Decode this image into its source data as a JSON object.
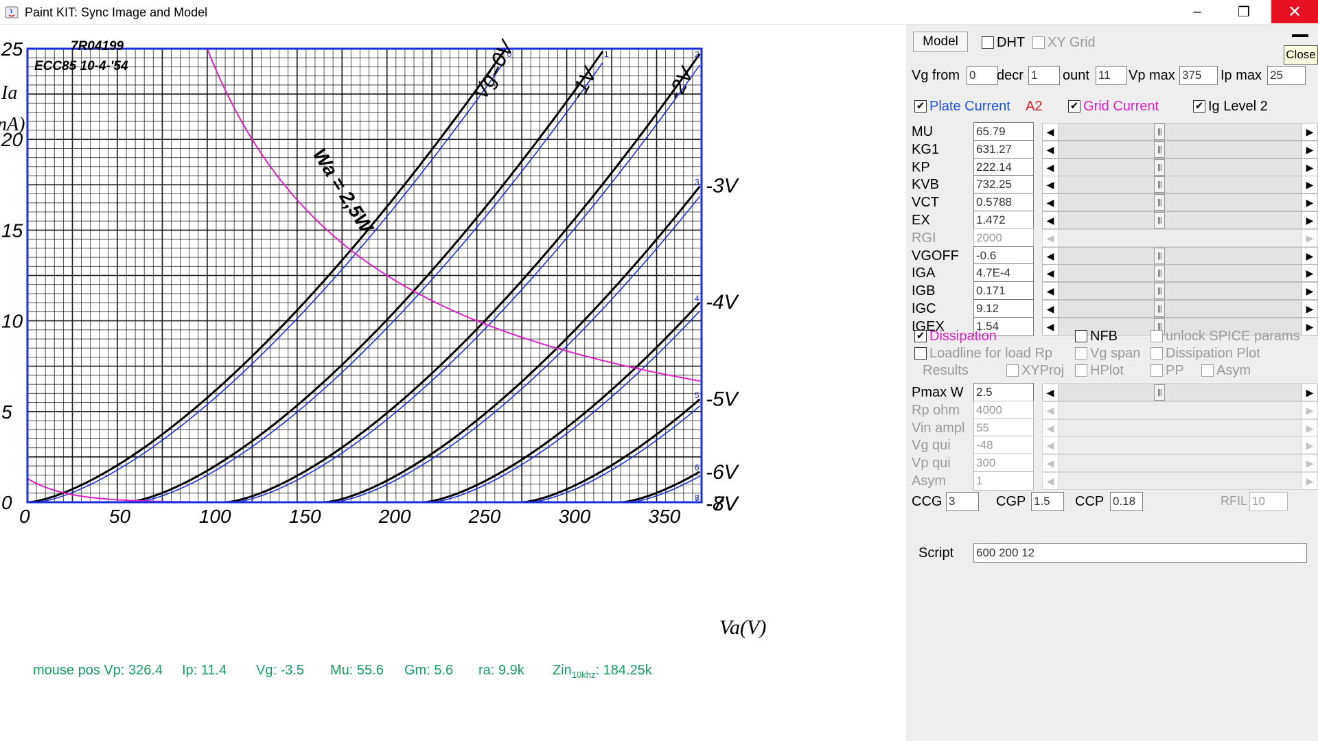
{
  "window": {
    "title": "Paint KIT: Sync Image and Model",
    "minimize": "–",
    "maximize": "❐",
    "close": "✕"
  },
  "chart_data": {
    "type": "line",
    "header_left": "7R04199",
    "header_date": "ECC85 10-4-'54",
    "ylabel_main": "Ia",
    "ylabel_unit": "nA)",
    "xlabel": "Va(V)",
    "x_ticks": [
      0,
      50,
      100,
      150,
      200,
      250,
      300,
      350
    ],
    "y_ticks": [
      0,
      5,
      10,
      15,
      20,
      25
    ],
    "xlim": [
      0,
      375
    ],
    "ylim": [
      0,
      25
    ],
    "dissipation_label": "Wa = 2,5W",
    "dissipation_watts": 2.5,
    "grid_labels": [
      {
        "text": "Vg=0V",
        "vg": 0
      },
      {
        "text": "-1V",
        "vg": -1
      },
      {
        "text": "-2V",
        "vg": -2
      },
      {
        "text": "-3V",
        "vg": -3
      },
      {
        "text": "-4V",
        "vg": -4
      },
      {
        "text": "-5V",
        "vg": -5
      },
      {
        "text": "-6V",
        "vg": -6
      },
      {
        "text": "-7V",
        "vg": -7
      },
      {
        "text": "-8V",
        "vg": -8
      }
    ],
    "series_colors": {
      "scan": "#000000",
      "model": "#1a2fe0",
      "dissipation": "#e020c8",
      "frame": "#1a2fe0"
    },
    "model_curve_ids": [
      "0",
      "1",
      "2",
      "3",
      "4",
      "5",
      "6",
      "7",
      "8"
    ]
  },
  "status": {
    "vp": "mouse pos Vp: 326.4",
    "ip": "Ip: 11.4",
    "vg": "Vg: -3.5",
    "mu": "Mu: 55.6",
    "gm": "Gm: 5.6",
    "ra": "ra: 9.9k",
    "zin_prefix": "Zin",
    "zin_sub": "10khz",
    "zin_value": ": 184.25k"
  },
  "panel": {
    "model_tab": "Model",
    "close_tooltip": "Close",
    "dht": "DHT",
    "xy_grid": "XY Grid",
    "vg_from_label": "Vg from",
    "vg_from": "0",
    "decr_label": "decr",
    "decr": "1",
    "count_label": "ount",
    "count": "11",
    "vpmax_label": "Vp max",
    "vpmax": "375",
    "ipmax_label": "Ip max",
    "ipmax": "25",
    "plate_current": "Plate Current",
    "a2": "A2",
    "grid_current": "Grid Current",
    "ig_level": "Ig Level 2",
    "params": [
      {
        "name": "MU",
        "value": "65.79",
        "enabled": true
      },
      {
        "name": "KG1",
        "value": "631.27",
        "enabled": true
      },
      {
        "name": "KP",
        "value": "222.14",
        "enabled": true
      },
      {
        "name": "KVB",
        "value": "732.25",
        "enabled": true
      },
      {
        "name": "VCT",
        "value": "0.5788",
        "enabled": true
      },
      {
        "name": "EX",
        "value": "1.472",
        "enabled": true
      },
      {
        "name": "RGI",
        "value": "2000",
        "enabled": false
      },
      {
        "name": "VGOFF",
        "value": "-0.6",
        "enabled": true
      },
      {
        "name": "IGA",
        "value": "4.7E-4",
        "enabled": true
      },
      {
        "name": "IGB",
        "value": "0.171",
        "enabled": true
      },
      {
        "name": "IGC",
        "value": "9.12",
        "enabled": true
      },
      {
        "name": "IGEX",
        "value": "1.54",
        "enabled": true
      }
    ],
    "dissipation": "Dissipation",
    "nfb": "NFB",
    "unlock_spice": "unlock SPICE params",
    "loadline": "Loadline for load Rp",
    "vg_span": "Vg span",
    "dissipation_plot": "Dissipation Plot",
    "results": "Results",
    "xyproj": "XYProj",
    "hplot": "HPlot",
    "pp": "PP",
    "asym": "Asym",
    "op_params": [
      {
        "name": "Pmax W",
        "value": "2.5",
        "enabled": true
      },
      {
        "name": "Rp ohm",
        "value": "4000",
        "enabled": false
      },
      {
        "name": "Vin ampl",
        "value": "55",
        "enabled": false
      },
      {
        "name": "Vg qui",
        "value": "-48",
        "enabled": false
      },
      {
        "name": "Vp qui",
        "value": "300",
        "enabled": false
      },
      {
        "name": "Asym",
        "value": "1",
        "enabled": false
      }
    ],
    "ccg_label": "CCG",
    "ccg": "3",
    "cgp_label": "CGP",
    "cgp": "1.5",
    "ccp_label": "CCP",
    "ccp": "0.18",
    "rfil_label": "RFIL",
    "rfil": "10",
    "script_label": "Script",
    "script": "600 200 12"
  }
}
